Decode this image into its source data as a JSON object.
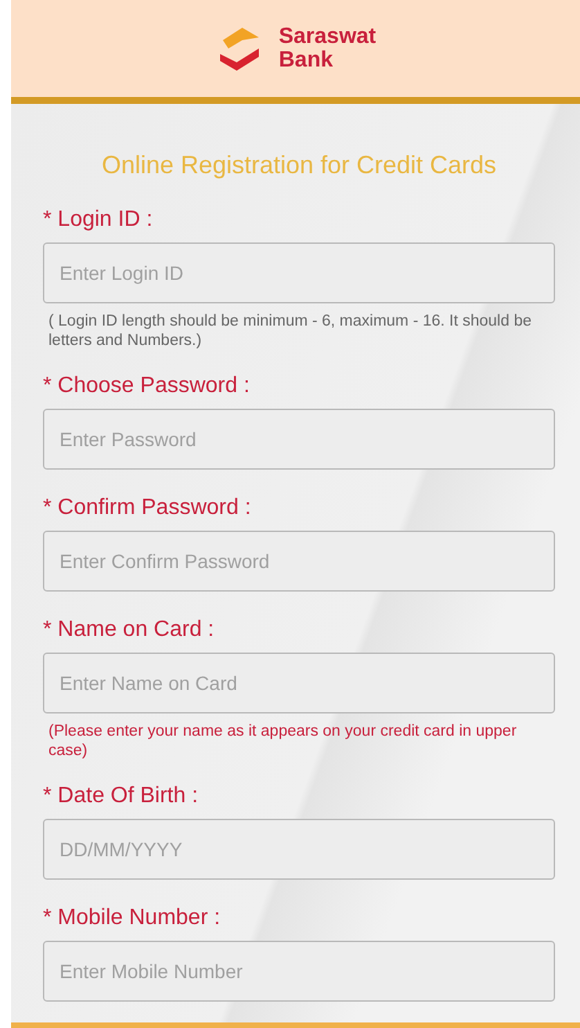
{
  "header": {
    "bank_name": [
      "Saraswat",
      "Bank"
    ]
  },
  "form": {
    "title": "Online Registration for Credit Cards",
    "fields": [
      {
        "label": "* Login ID :",
        "placeholder": "Enter Login ID",
        "hint": {
          "kind": "info",
          "text": "( Login ID length should be minimum - 6, maximum - 16. It should be letters and Numbers.)"
        }
      },
      {
        "label": "* Choose Password :",
        "placeholder": "Enter Password"
      },
      {
        "label": "* Confirm Password :",
        "placeholder": "Enter Confirm Password"
      },
      {
        "label": "* Name on Card :",
        "placeholder": "Enter Name on Card",
        "hint": {
          "kind": "alert",
          "text": "(Please enter your name as it appears on your credit card in upper case)"
        }
      },
      {
        "label": "* Date Of Birth :",
        "placeholder": "DD/MM/YYYY"
      },
      {
        "label": "* Mobile Number :",
        "placeholder": "Enter Mobile Number"
      }
    ]
  }
}
